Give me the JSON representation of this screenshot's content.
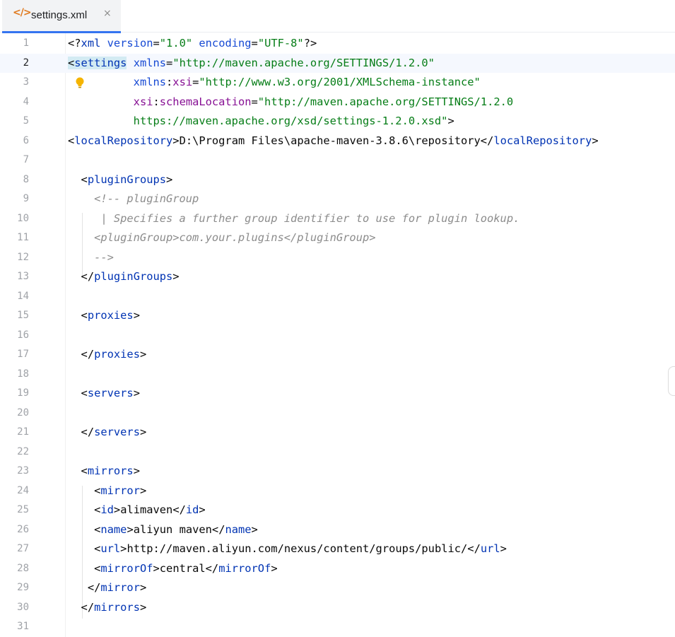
{
  "tab": {
    "icon": "xml-file-icon",
    "label": "settings.xml",
    "close": "×"
  },
  "line_numbers": [
    "1",
    "2",
    "3",
    "4",
    "5",
    "6",
    "7",
    "8",
    "9",
    "10",
    "11",
    "12",
    "13",
    "14",
    "15",
    "16",
    "17",
    "18",
    "19",
    "20",
    "21",
    "22",
    "23",
    "24",
    "25",
    "26",
    "27",
    "28",
    "29",
    "30",
    "31"
  ],
  "code": {
    "l1": {
      "decl_open": "<?",
      "decl_name": "xml",
      "a1": " version",
      "eq1": "=",
      "v1": "\"1.0\"",
      "a2": " encoding",
      "eq2": "=",
      "v2": "\"UTF-8\"",
      "decl_close": "?>"
    },
    "l2": {
      "open": "<",
      "tag": "settings",
      "attr": " xmlns",
      "eq": "=",
      "val": "\"http://maven.apache.org/SETTINGS/1.2.0\""
    },
    "l3": {
      "indent": "          ",
      "prefix": "xmlns",
      "colon": ":",
      "name": "xsi",
      "eq": "=",
      "val": "\"http://www.w3.org/2001/XMLSchema-instance\""
    },
    "l4": {
      "indent": "          ",
      "prefix": "xsi",
      "colon": ":",
      "name": "schemaLocation",
      "eq": "=",
      "val": "\"http://maven.apache.org/SETTINGS/1.2.0"
    },
    "l5": {
      "indent": "          ",
      "val": "https://maven.apache.org/xsd/settings-1.2.0.xsd\"",
      "close": ">"
    },
    "l6": {
      "o1": "<",
      "tag1": "localRepository",
      "c1": ">",
      "text": "D:\\Program Files\\apache-maven-3.8.6\\repository",
      "o2": "</",
      "tag2": "localRepository",
      "c2": ">"
    },
    "l8": {
      "indent": "  ",
      "o": "<",
      "tag": "pluginGroups",
      "c": ">"
    },
    "l9": {
      "text": "    <!-- pluginGroup"
    },
    "l10": {
      "text": "     | Specifies a further group identifier to use for plugin lookup."
    },
    "l11": {
      "text": "    <pluginGroup>com.your.plugins</pluginGroup>"
    },
    "l12": {
      "text": "    -->"
    },
    "l13": {
      "indent": "  ",
      "o": "</",
      "tag": "pluginGroups",
      "c": ">"
    },
    "l15": {
      "indent": "  ",
      "o": "<",
      "tag": "proxies",
      "c": ">"
    },
    "l17": {
      "indent": "  ",
      "o": "</",
      "tag": "proxies",
      "c": ">"
    },
    "l19": {
      "indent": "  ",
      "o": "<",
      "tag": "servers",
      "c": ">"
    },
    "l21": {
      "indent": "  ",
      "o": "</",
      "tag": "servers",
      "c": ">"
    },
    "l23": {
      "indent": "  ",
      "o": "<",
      "tag": "mirrors",
      "c": ">"
    },
    "l24": {
      "indent": "    ",
      "o": "<",
      "tag": "mirror",
      "c": ">"
    },
    "l25": {
      "indent": "    ",
      "o1": "<",
      "tag1": "id",
      "c1": ">",
      "text": "alimaven",
      "o2": "</",
      "tag2": "id",
      "c2": ">"
    },
    "l26": {
      "indent": "    ",
      "o1": "<",
      "tag1": "name",
      "c1": ">",
      "text": "aliyun maven",
      "o2": "</",
      "tag2": "name",
      "c2": ">"
    },
    "l27": {
      "indent": "    ",
      "o1": "<",
      "tag1": "url",
      "c1": ">",
      "text": "http://maven.aliyun.com/nexus/content/groups/public/",
      "o2": "</",
      "tag2": "url",
      "c2": ">"
    },
    "l28": {
      "indent": "    ",
      "o1": "<",
      "tag1": "mirrorOf",
      "c1": ">",
      "text": "central",
      "o2": "</",
      "tag2": "mirrorOf",
      "c2": ">"
    },
    "l29": {
      "indent": "   ",
      "o": "</",
      "tag": "mirror",
      "c": ">"
    },
    "l30": {
      "indent": "  ",
      "o": "</",
      "tag": "mirrors",
      "c": ">"
    }
  },
  "colors": {
    "tag": "#0033b3",
    "attribute": "#174ad4",
    "namespace": "#871094",
    "value": "#067d17",
    "comment": "#8c8c8c",
    "accent": "#3574f0",
    "bulb": "#f5b400"
  },
  "gutter_icon": "lightbulb-icon"
}
